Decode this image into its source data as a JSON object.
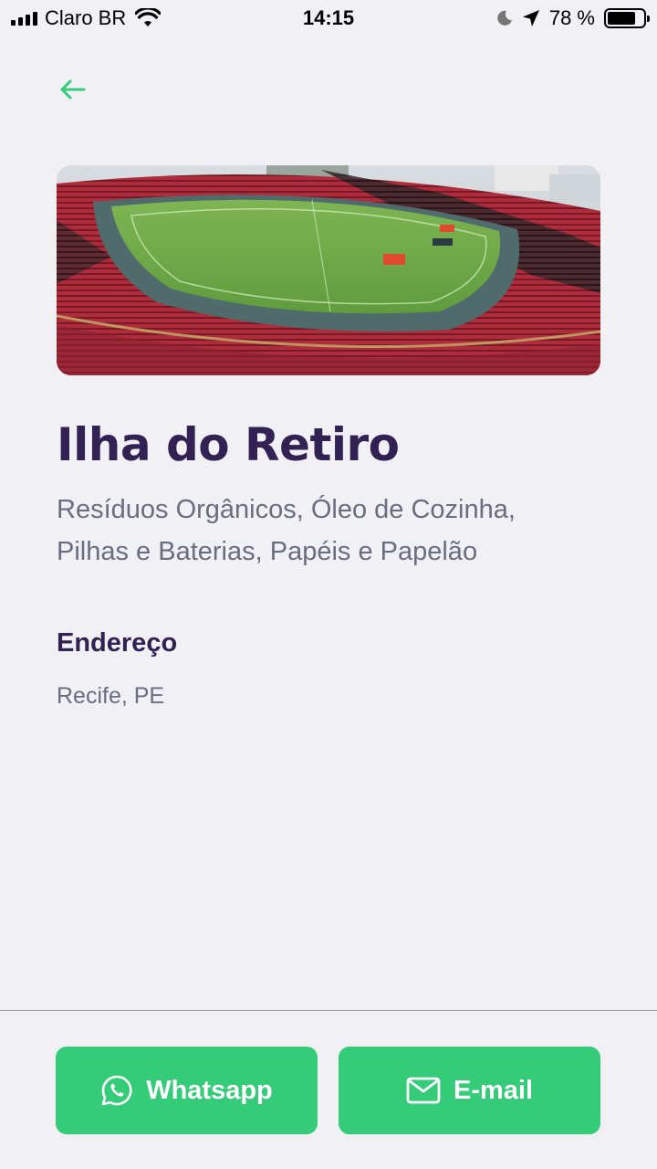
{
  "status_bar": {
    "carrier": "Claro BR",
    "time": "14:15",
    "battery_percent": "78 %",
    "battery_level": 0.78
  },
  "point": {
    "name": "Ilha do Retiro",
    "items_line1": "Resíduos Orgânicos, Óleo de Cozinha,",
    "items_line2": "Pilhas e Baterias, Papéis e Papelão"
  },
  "address": {
    "title": "Endereço",
    "value": "Recife, PE"
  },
  "footer": {
    "whatsapp_label": "Whatsapp",
    "email_label": "E-mail"
  },
  "colors": {
    "accent": "#34cb79",
    "title": "#322153",
    "text": "#6c6c80",
    "background": "#f0f0f5"
  },
  "icons": {
    "back": "arrow-left-icon",
    "whatsapp": "whatsapp-icon",
    "email": "mail-icon"
  }
}
